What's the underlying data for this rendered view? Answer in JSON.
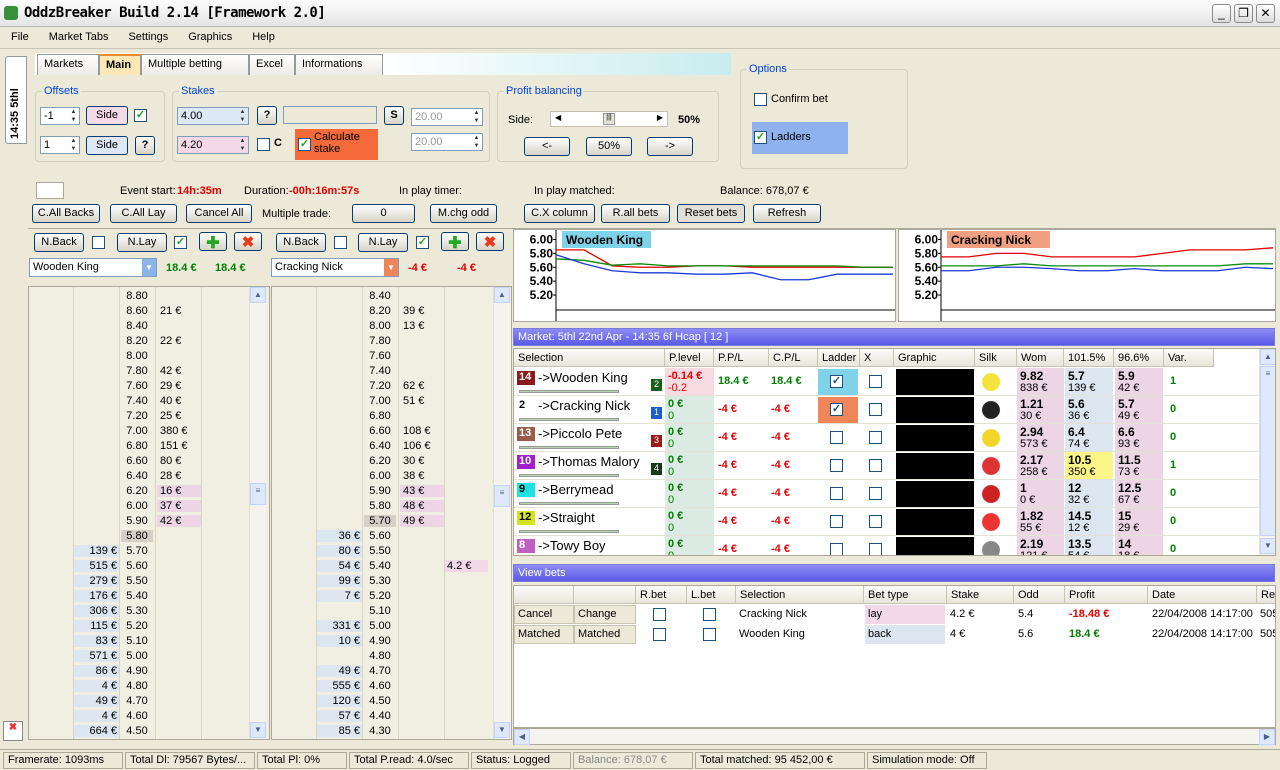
{
  "window": {
    "title": "OddzBreaker Build 2.14 [Framework 2.0]"
  },
  "menu": [
    "File",
    "Market Tabs",
    "Settings",
    "Graphics",
    "Help"
  ],
  "side_tab": "14:35 5thl",
  "tabs": [
    "Markets",
    "Main",
    "Multiple betting",
    "Excel",
    "Informations"
  ],
  "offsets": {
    "label": "Offsets",
    "v1": "-1",
    "v2": "1",
    "side": "Side",
    "help": "?"
  },
  "stakes": {
    "label": "Stakes",
    "v1": "4.00",
    "v2": "4.20",
    "help": "?",
    "s": "S",
    "c": "C",
    "calc": "Calculate stake",
    "s1": "20.00",
    "s2": "20.00"
  },
  "profit": {
    "label": "Profit balancing",
    "side": "Side:",
    "pct": "50%",
    "left": "<-",
    "mid": "50%",
    "right": "->",
    "pos": 0.5
  },
  "options": {
    "label": "Options",
    "confirm": "Confirm bet",
    "ladders": "Ladders"
  },
  "info": {
    "event_start_lbl": "Event start:",
    "event_start": "14h:35m",
    "duration_lbl": "Duration:",
    "duration": "-00h:16m:57s",
    "inplay_timer": "In play timer:",
    "inplay_matched": "In play matched:",
    "balance": "Balance: 678,07 €"
  },
  "actions": {
    "call_backs": "C.All Backs",
    "call_lay": "C.All Lay",
    "cancel_all": "Cancel All",
    "multiple_trade": "Multiple trade:",
    "trade_val": "0",
    "mchg": "M.chg odd",
    "cx": "C.X column",
    "rall": "R.all bets",
    "reset": "Reset bets",
    "refresh": "Refresh"
  },
  "ladder1": {
    "nback": "N.Back",
    "nlay": "N.Lay",
    "runner": "Wooden King",
    "pl1": "18.4 €",
    "pl2": "18.4 €",
    "rows": [
      [
        "",
        "8.80",
        "",
        ""
      ],
      [
        "",
        "8.60",
        "21 €",
        ""
      ],
      [
        "",
        "8.40",
        "",
        ""
      ],
      [
        "",
        "8.20",
        "22 €",
        ""
      ],
      [
        "",
        "8.00",
        "",
        ""
      ],
      [
        "",
        "7.80",
        "42 €",
        ""
      ],
      [
        "",
        "7.60",
        "29 €",
        ""
      ],
      [
        "",
        "7.40",
        "40 €",
        ""
      ],
      [
        "",
        "7.20",
        "25 €",
        ""
      ],
      [
        "",
        "7.00",
        "380 €",
        ""
      ],
      [
        "",
        "6.80",
        "151 €",
        ""
      ],
      [
        "",
        "6.60",
        "80 €",
        ""
      ],
      [
        "",
        "6.40",
        "28 €",
        ""
      ],
      [
        "",
        "6.20",
        "16 €",
        ""
      ],
      [
        "",
        "6.00",
        "37 €",
        ""
      ],
      [
        "",
        "5.90",
        "42 €",
        ""
      ],
      [
        "",
        "5.80",
        "",
        ""
      ],
      [
        "139 €",
        "5.70",
        "",
        ""
      ],
      [
        "515 €",
        "5.60",
        "",
        ""
      ],
      [
        "279 €",
        "5.50",
        "",
        ""
      ],
      [
        "176 €",
        "5.40",
        "",
        ""
      ],
      [
        "306 €",
        "5.30",
        "",
        ""
      ],
      [
        "115 €",
        "5.20",
        "",
        ""
      ],
      [
        "83 €",
        "5.10",
        "",
        ""
      ],
      [
        "571 €",
        "5.00",
        "",
        ""
      ],
      [
        "86 €",
        "4.90",
        "",
        ""
      ],
      [
        "4 €",
        "4.80",
        "",
        ""
      ],
      [
        "49 €",
        "4.70",
        "",
        ""
      ],
      [
        "4 €",
        "4.60",
        "",
        ""
      ],
      [
        "664 €",
        "4.50",
        "",
        ""
      ]
    ]
  },
  "ladder2": {
    "nback": "N.Back",
    "nlay": "N.Lay",
    "runner": "Cracking Nick",
    "pl1": "-4 €",
    "pl2": "-4 €",
    "rows": [
      [
        "",
        "8.40",
        "",
        ""
      ],
      [
        "",
        "8.20",
        "39 €",
        ""
      ],
      [
        "",
        "8.00",
        "13 €",
        ""
      ],
      [
        "",
        "7.80",
        "",
        ""
      ],
      [
        "",
        "7.60",
        "",
        ""
      ],
      [
        "",
        "7.40",
        "",
        ""
      ],
      [
        "",
        "7.20",
        "62 €",
        ""
      ],
      [
        "",
        "7.00",
        "51 €",
        ""
      ],
      [
        "",
        "6.80",
        "",
        ""
      ],
      [
        "",
        "6.60",
        "108 €",
        ""
      ],
      [
        "",
        "6.40",
        "106 €",
        ""
      ],
      [
        "",
        "6.20",
        "30 €",
        ""
      ],
      [
        "",
        "6.00",
        "38 €",
        ""
      ],
      [
        "",
        "5.90",
        "43 €",
        ""
      ],
      [
        "",
        "5.80",
        "48 €",
        ""
      ],
      [
        "",
        "5.70",
        "49 €",
        ""
      ],
      [
        "36 €",
        "5.60",
        "",
        ""
      ],
      [
        "80 €",
        "5.50",
        "",
        ""
      ],
      [
        "54 €",
        "5.40",
        "",
        "4.2 €"
      ],
      [
        "99 €",
        "5.30",
        "",
        ""
      ],
      [
        "7 €",
        "5.20",
        "",
        ""
      ],
      [
        "",
        "5.10",
        "",
        ""
      ],
      [
        "331 €",
        "5.00",
        "",
        ""
      ],
      [
        "10 €",
        "4.90",
        "",
        ""
      ],
      [
        "",
        "4.80",
        "",
        ""
      ],
      [
        "49 €",
        "4.70",
        "",
        ""
      ],
      [
        "555 €",
        "4.60",
        "",
        ""
      ],
      [
        "120 €",
        "4.50",
        "",
        ""
      ],
      [
        "57 €",
        "4.40",
        "",
        ""
      ],
      [
        "85 €",
        "4.30",
        "",
        ""
      ]
    ]
  },
  "chart1": {
    "title": "Wooden King",
    "ticks": [
      "6.00",
      "5.80",
      "5.60",
      "5.40",
      "5.20"
    ],
    "ylim": [
      5.1,
      6.05
    ],
    "red": [
      5.85,
      5.85,
      5.62,
      5.6,
      5.6,
      5.62,
      5.62,
      5.6,
      5.6,
      5.6,
      5.6,
      5.6,
      5.6
    ],
    "green": [
      5.72,
      5.7,
      5.63,
      5.65,
      5.62,
      5.62,
      5.62,
      5.62,
      5.62,
      5.62,
      5.62,
      5.6,
      5.6
    ],
    "blue": [
      5.78,
      5.65,
      5.55,
      5.52,
      5.52,
      5.5,
      5.5,
      5.52,
      5.42,
      5.42,
      5.5,
      5.5,
      5.5
    ]
  },
  "chart2": {
    "title": "Cracking Nick",
    "ticks": [
      "6.00",
      "5.80",
      "5.60",
      "5.40",
      "5.20"
    ],
    "ylim": [
      5.1,
      6.05
    ],
    "red": [
      5.75,
      5.75,
      5.8,
      5.8,
      5.75,
      5.75,
      5.75,
      5.75,
      5.8,
      5.85,
      5.85,
      5.85,
      5.88
    ],
    "green": [
      5.62,
      5.62,
      5.62,
      5.65,
      5.62,
      5.62,
      5.62,
      5.62,
      5.62,
      5.62,
      5.62,
      5.65,
      5.65
    ],
    "blue": [
      5.55,
      5.55,
      5.6,
      5.6,
      5.58,
      5.55,
      5.55,
      5.58,
      5.55,
      5.55,
      5.55,
      5.6,
      5.58
    ]
  },
  "market": {
    "header": "Market: 5thl 22nd Apr - 14:35 6f Hcap [ 12 ]",
    "cols": [
      "Selection",
      "P.level",
      "P.P/L",
      "C.P/L",
      "Ladder",
      "X",
      "Graphic",
      "Silk",
      "Wom",
      "101.5%",
      "96.6%",
      "Var."
    ],
    "runners": [
      {
        "num": "14",
        "name": "->Wooden King",
        "badge": "2",
        "numcolor": "#8b1a1a",
        "pl1": "-0.14 €",
        "pl2": "-0.2",
        "ppl": "18.4 €",
        "cpl": "18.4 €",
        "ladder": true,
        "wom1": "9.82",
        "wom2": "838 €",
        "b1": "5.7",
        "b2": "139 €",
        "l1": "5.9",
        "l2": "42 €",
        "var": "1"
      },
      {
        "num": "2",
        "name": "->Cracking Nick",
        "badge": "1",
        "numcolor": "#ffffff",
        "pl1": "0 €",
        "pl2": "0",
        "ppl": "-4 €",
        "cpl": "-4 €",
        "ladder": true,
        "wom1": "1.21",
        "wom2": "30 €",
        "b1": "5.6",
        "b2": "36 €",
        "l1": "5.7",
        "l2": "49 €",
        "var": "0"
      },
      {
        "num": "13",
        "name": "->Piccolo Pete",
        "badge": "3",
        "numcolor": "#9b5b4b",
        "pl1": "0 €",
        "pl2": "0",
        "ppl": "-4 €",
        "cpl": "-4 €",
        "ladder": false,
        "wom1": "2.94",
        "wom2": "573 €",
        "b1": "6.4",
        "b2": "74 €",
        "l1": "6.6",
        "l2": "93 €",
        "var": "0"
      },
      {
        "num": "10",
        "name": "->Thomas Malory",
        "badge": "4",
        "numcolor": "#a020d0",
        "pl1": "0 €",
        "pl2": "0",
        "ppl": "-4 €",
        "cpl": "-4 €",
        "ladder": false,
        "wom1": "2.17",
        "wom2": "258 €",
        "b1": "10.5",
        "b2": "350 €",
        "l1": "11.5",
        "l2": "73 €",
        "var": "1"
      },
      {
        "num": "9",
        "name": "->Berrymead",
        "badge": "",
        "numcolor": "#20e0e0",
        "pl1": "0 €",
        "pl2": "0",
        "ppl": "-4 €",
        "cpl": "-4 €",
        "ladder": false,
        "wom1": "1",
        "wom2": "0 €",
        "b1": "12",
        "b2": "32 €",
        "l1": "12.5",
        "l2": "67 €",
        "var": "0"
      },
      {
        "num": "12",
        "name": "->Straight",
        "badge": "",
        "numcolor": "#d4e41a",
        "pl1": "0 €",
        "pl2": "0",
        "ppl": "-4 €",
        "cpl": "-4 €",
        "ladder": false,
        "wom1": "1.82",
        "wom2": "55 €",
        "b1": "14.5",
        "b2": "12 €",
        "l1": "15",
        "l2": "29 €",
        "var": "0"
      },
      {
        "num": "8",
        "name": "->Towy Boy",
        "badge": "",
        "numcolor": "#c060c0",
        "pl1": "0 €",
        "pl2": "0",
        "ppl": "-4 €",
        "cpl": "-4 €",
        "ladder": false,
        "wom1": "2.19",
        "wom2": "121 €",
        "b1": "13.5",
        "b2": "54 €",
        "l1": "14",
        "l2": "18 €",
        "var": "0"
      }
    ]
  },
  "bets": {
    "header": "View bets",
    "cols": [
      "",
      "",
      "R.bet",
      "L.bet",
      "Selection",
      "Bet type",
      "Stake",
      "Odd",
      "Profit",
      "Date",
      "Re"
    ],
    "rows": [
      [
        "Cancel",
        "Change",
        "Cracking Nick",
        "lay",
        "4.2 €",
        "5.4",
        "-18.48 €",
        "22/04/2008 14:17:00",
        "505"
      ],
      [
        "Matched",
        "Matched",
        "Wooden King",
        "back",
        "4 €",
        "5.6",
        "18.4 €",
        "22/04/2008 14:17:00",
        "505"
      ]
    ]
  },
  "status": [
    "Framerate: 1093ms",
    "Total Dl: 79567 Bytes/...",
    "Total Pl: 0%",
    "Total P.read: 4.0/sec",
    "Status: Logged",
    "Balance: 678,07 €",
    "Total matched: 95 452,00 €",
    "Simulation mode: Off"
  ]
}
